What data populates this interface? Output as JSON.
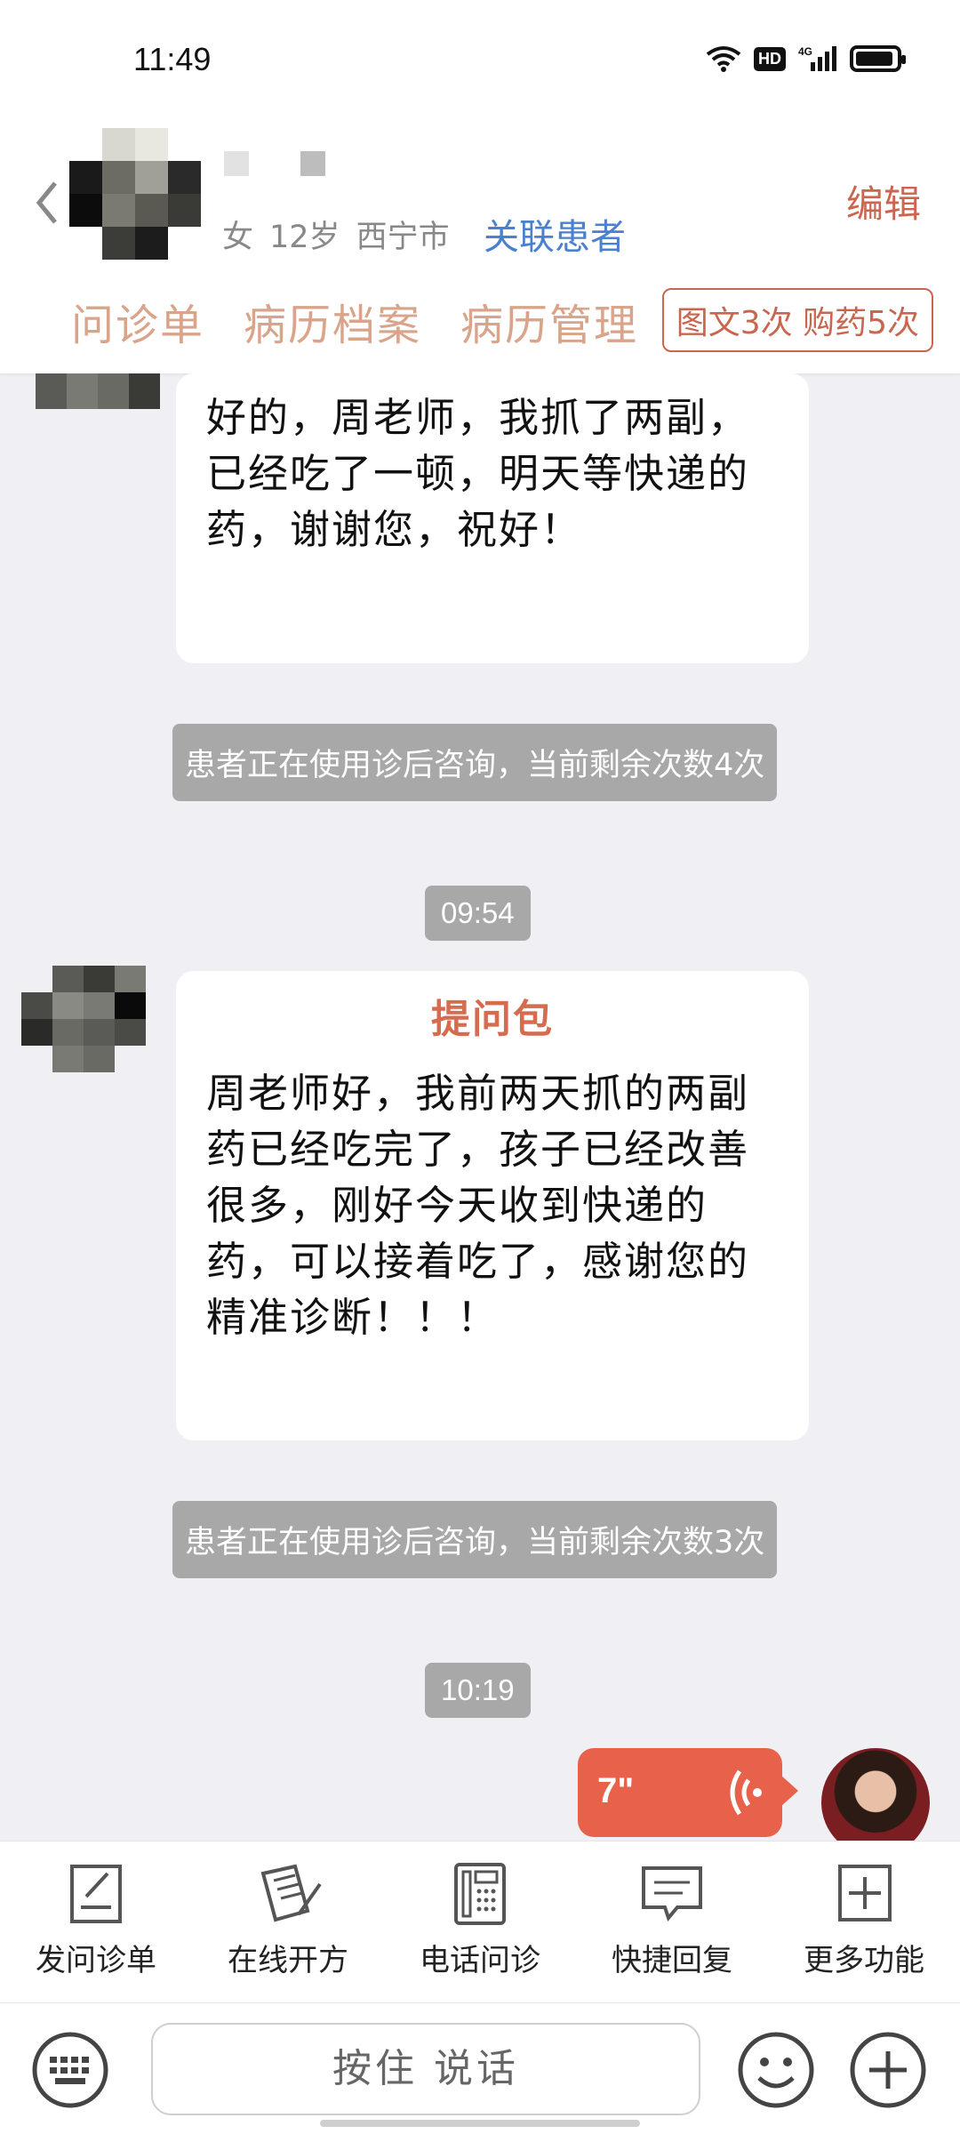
{
  "status_bar": {
    "time": "11:49",
    "hd": "HD",
    "network": "4G"
  },
  "header": {
    "patient_gender": "女",
    "patient_age": "12岁",
    "patient_city": "西宁市",
    "link_patient": "关联患者",
    "edit": "编辑",
    "tabs": [
      "问诊单",
      "病历档案",
      "病历管理"
    ],
    "quota": "图文3次 购药5次"
  },
  "messages": [
    {
      "type": "patient",
      "text": "好的，周老师，我抓了两副，已经吃了一顿，明天等快递的药，谢谢您，祝好！"
    },
    {
      "type": "system",
      "text": "患者正在使用诊后咨询，当前剩余次数4次"
    },
    {
      "type": "time",
      "text": "09:54"
    },
    {
      "type": "patient",
      "title": "提问包",
      "text": "周老师好，我前两天抓的两副药已经吃完了，孩子已经改善很多，刚好今天收到快递的药，可以接着吃了，感谢您的精准诊断！！！"
    },
    {
      "type": "system",
      "text": "患者正在使用诊后咨询，当前剩余次数3次"
    },
    {
      "type": "time",
      "text": "10:19"
    },
    {
      "type": "doctor-voice",
      "duration": "7\""
    }
  ],
  "toolbar": {
    "items": [
      {
        "label": "发问诊单",
        "icon": "form-icon"
      },
      {
        "label": "在线开方",
        "icon": "prescription-icon"
      },
      {
        "label": "电话问诊",
        "icon": "phone-icon"
      },
      {
        "label": "快捷回复",
        "icon": "quick-reply-icon"
      },
      {
        "label": "更多功能",
        "icon": "more-icon"
      }
    ]
  },
  "input_bar": {
    "hold_to_talk": "按住 说话"
  },
  "colors": {
    "accent": "#c8664f",
    "link": "#4b7fcf",
    "voice_bubble": "#e8624b",
    "system_note": "#a8a8a8"
  }
}
